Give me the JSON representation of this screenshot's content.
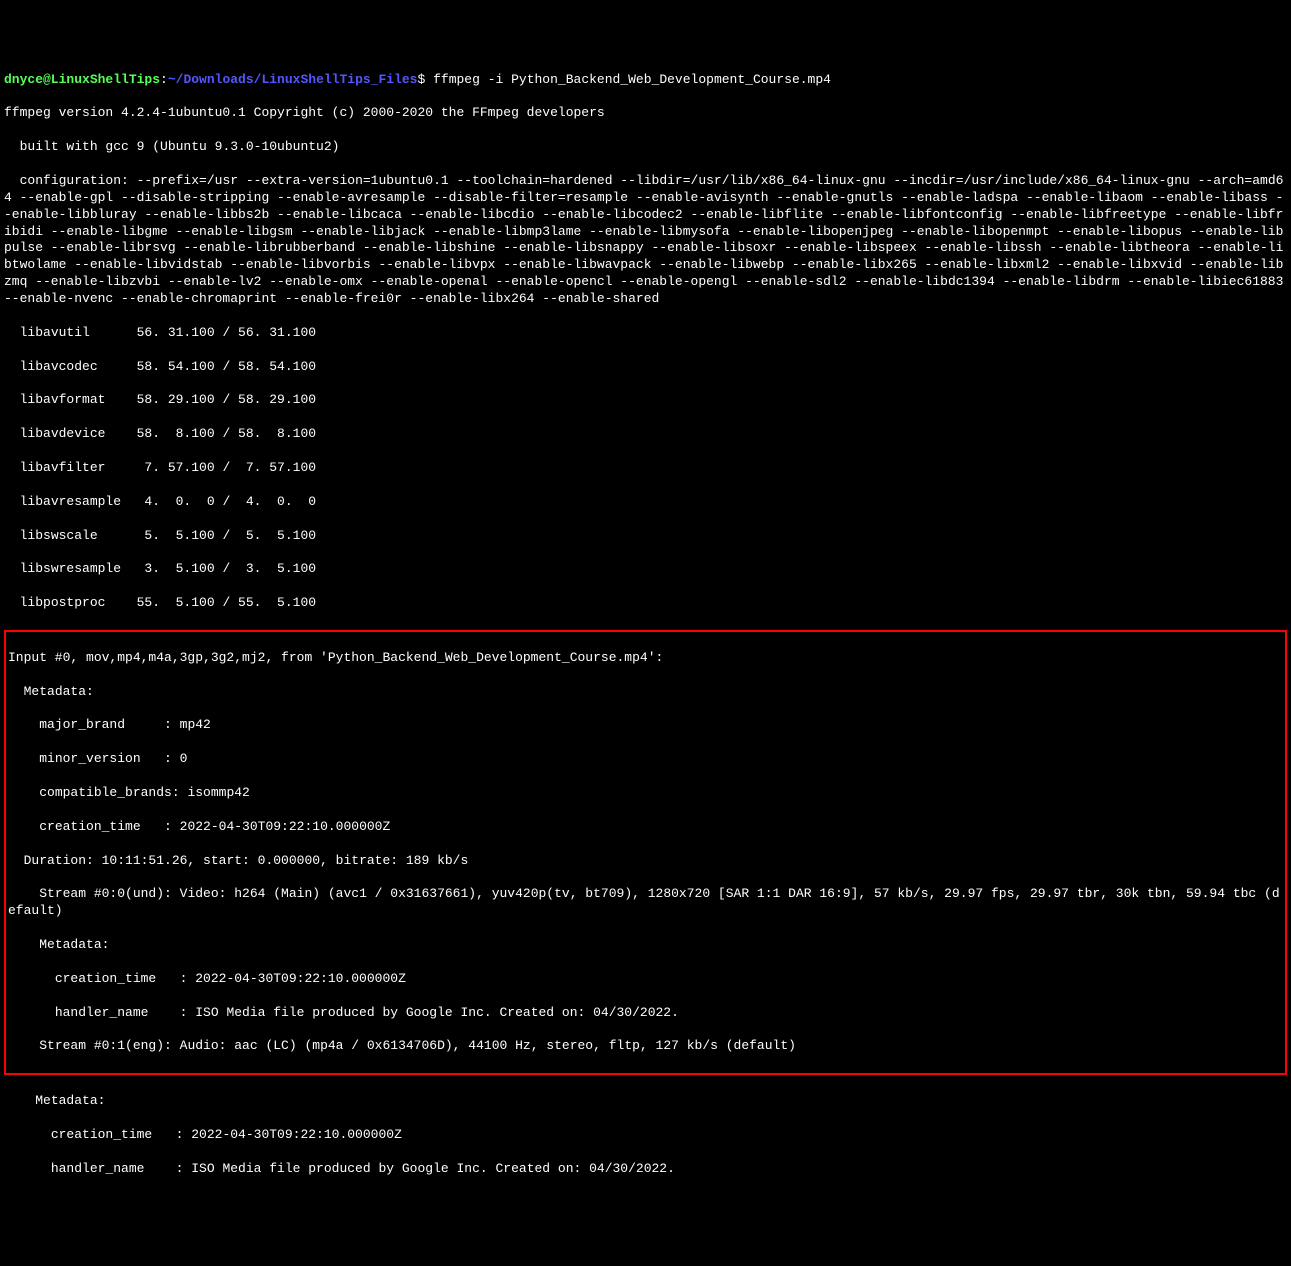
{
  "prompt": {
    "user_host": "dnyce@LinuxShellTips",
    "colon1": ":",
    "path": "~/Downloads/LinuxShellTips_Files",
    "dollar": "$ ",
    "command": "ffmpeg -i Python_Backend_Web_Development_Course.mp4"
  },
  "output": {
    "version_line": "ffmpeg version 4.2.4-1ubuntu0.1 Copyright (c) 2000-2020 the FFmpeg developers",
    "built_line": "  built with gcc 9 (Ubuntu 9.3.0-10ubuntu2)",
    "config_line": "  configuration: --prefix=/usr --extra-version=1ubuntu0.1 --toolchain=hardened --libdir=/usr/lib/x86_64-linux-gnu --incdir=/usr/include/x86_64-linux-gnu --arch=amd64 --enable-gpl --disable-stripping --enable-avresample --disable-filter=resample --enable-avisynth --enable-gnutls --enable-ladspa --enable-libaom --enable-libass --enable-libbluray --enable-libbs2b --enable-libcaca --enable-libcdio --enable-libcodec2 --enable-libflite --enable-libfontconfig --enable-libfreetype --enable-libfribidi --enable-libgme --enable-libgsm --enable-libjack --enable-libmp3lame --enable-libmysofa --enable-libopenjpeg --enable-libopenmpt --enable-libopus --enable-libpulse --enable-librsvg --enable-librubberband --enable-libshine --enable-libsnappy --enable-libsoxr --enable-libspeex --enable-libssh --enable-libtheora --enable-libtwolame --enable-libvidstab --enable-libvorbis --enable-libvpx --enable-libwavpack --enable-libwebp --enable-libx265 --enable-libxml2 --enable-libxvid --enable-libzmq --enable-libzvbi --enable-lv2 --enable-omx --enable-openal --enable-opencl --enable-opengl --enable-sdl2 --enable-libdc1394 --enable-libdrm --enable-libiec61883 --enable-nvenc --enable-chromaprint --enable-frei0r --enable-libx264 --enable-shared",
    "libavutil": "  libavutil      56. 31.100 / 56. 31.100",
    "libavcodec": "  libavcodec     58. 54.100 / 58. 54.100",
    "libavformat": "  libavformat    58. 29.100 / 58. 29.100",
    "libavdevice": "  libavdevice    58.  8.100 / 58.  8.100",
    "libavfilter": "  libavfilter     7. 57.100 /  7. 57.100",
    "libavresample": "  libavresample   4.  0.  0 /  4.  0.  0",
    "libswscale": "  libswscale      5.  5.100 /  5.  5.100",
    "libswresample": "  libswresample   3.  5.100 /  3.  5.100",
    "libpostproc": "  libpostproc    55.  5.100 / 55.  5.100"
  },
  "highlighted": {
    "input_line": "Input #0, mov,mp4,m4a,3gp,3g2,mj2, from 'Python_Backend_Web_Development_Course.mp4':",
    "metadata1": "  Metadata:",
    "major_brand": "    major_brand     : mp42",
    "minor_version": "    minor_version   : 0",
    "compatible_brands": "    compatible_brands: isommp42",
    "creation_time1": "    creation_time   : 2022-04-30T09:22:10.000000Z",
    "duration": "  Duration: 10:11:51.26, start: 0.000000, bitrate: 189 kb/s",
    "stream0": "    Stream #0:0(und): Video: h264 (Main) (avc1 / 0x31637661), yuv420p(tv, bt709), 1280x720 [SAR 1:1 DAR 16:9], 57 kb/s, 29.97 fps, 29.97 tbr, 30k tbn, 59.94 tbc (default)",
    "metadata2": "    Metadata:",
    "creation_time2": "      creation_time   : 2022-04-30T09:22:10.000000Z",
    "handler_name1": "      handler_name    : ISO Media file produced by Google Inc. Created on: 04/30/2022.",
    "stream1": "    Stream #0:1(eng): Audio: aac (LC) (mp4a / 0x6134706D), 44100 Hz, stereo, fltp, 127 kb/s (default)"
  },
  "after": {
    "metadata3": "    Metadata:",
    "creation_time3": "      creation_time   : 2022-04-30T09:22:10.000000Z",
    "handler_name2": "      handler_name    : ISO Media file produced by Google Inc. Created on: 04/30/2022."
  }
}
